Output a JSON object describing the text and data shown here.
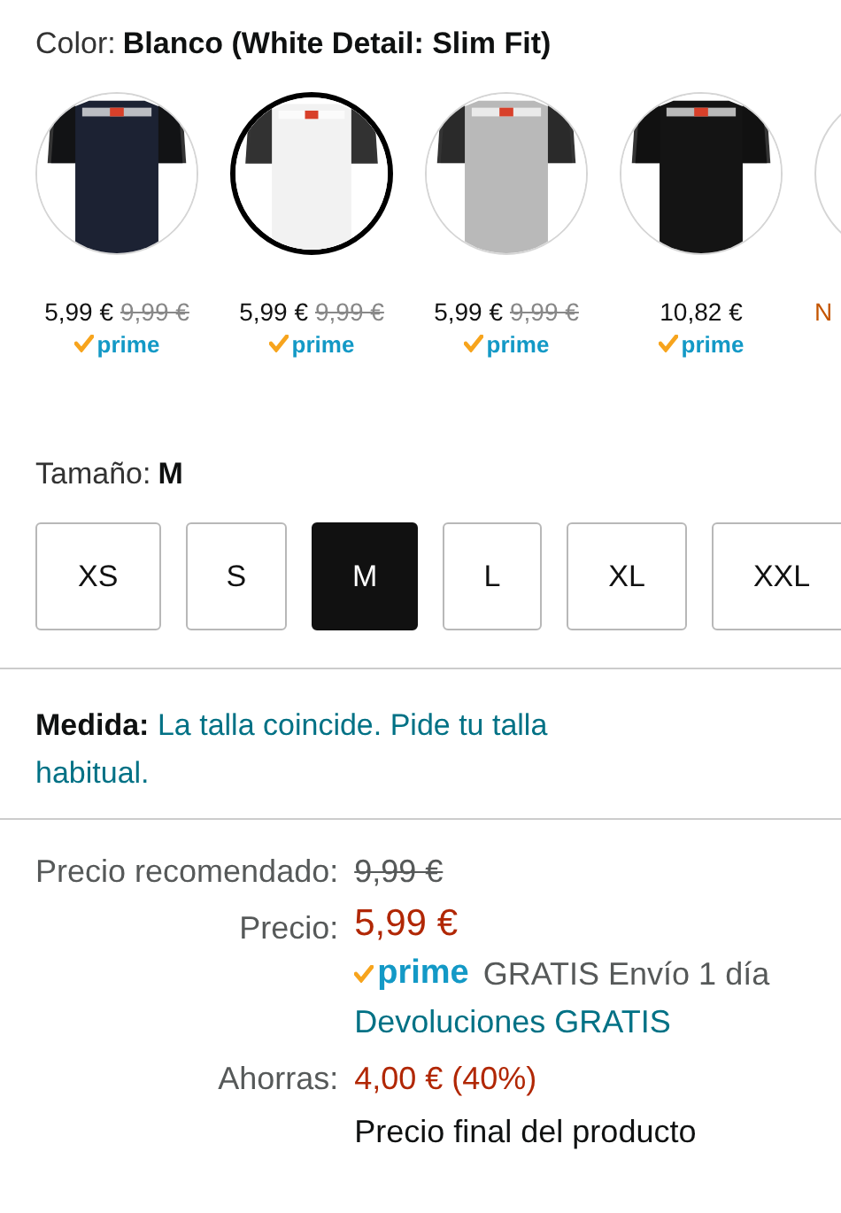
{
  "color_selector": {
    "label": "Color:",
    "value": "Blanco (White Detail: Slim Fit)",
    "swatches": [
      {
        "color": "#1c2233",
        "price": "5,99 €",
        "list_price": "9,99 €",
        "prime": "prime",
        "selected": false
      },
      {
        "color": "#f2f2f2",
        "price": "5,99 €",
        "list_price": "9,99 €",
        "prime": "prime",
        "selected": true
      },
      {
        "color": "#b9b9b9",
        "price": "5,99 €",
        "list_price": "9,99 €",
        "prime": "prime",
        "selected": false
      },
      {
        "color": "#141414",
        "price": "10,82 €",
        "prime": "prime",
        "selected": false
      },
      {
        "price": "N",
        "selected": false,
        "kind": "deal"
      }
    ]
  },
  "size_selector": {
    "label": "Tamaño:",
    "value": "M",
    "sizes": [
      {
        "label": "XS",
        "selected": false
      },
      {
        "label": "S",
        "selected": false
      },
      {
        "label": "M",
        "selected": true
      },
      {
        "label": "L",
        "selected": false
      },
      {
        "label": "XL",
        "selected": false
      },
      {
        "label": "XXL",
        "selected": false
      }
    ]
  },
  "fit": {
    "label": "Medida:",
    "text": "La talla coincide. Pide tu talla habitual."
  },
  "pricing": {
    "list_price_label": "Precio recomendado:",
    "list_price": "9,99 €",
    "price_label": "Precio:",
    "price": "5,99 €",
    "prime": "prime",
    "delivery": "GRATIS Envío 1 día",
    "returns": "Devoluciones GRATIS",
    "savings_label": "Ahorras:",
    "savings": "4,00 € (40%)",
    "note": "Precio final del producto"
  }
}
